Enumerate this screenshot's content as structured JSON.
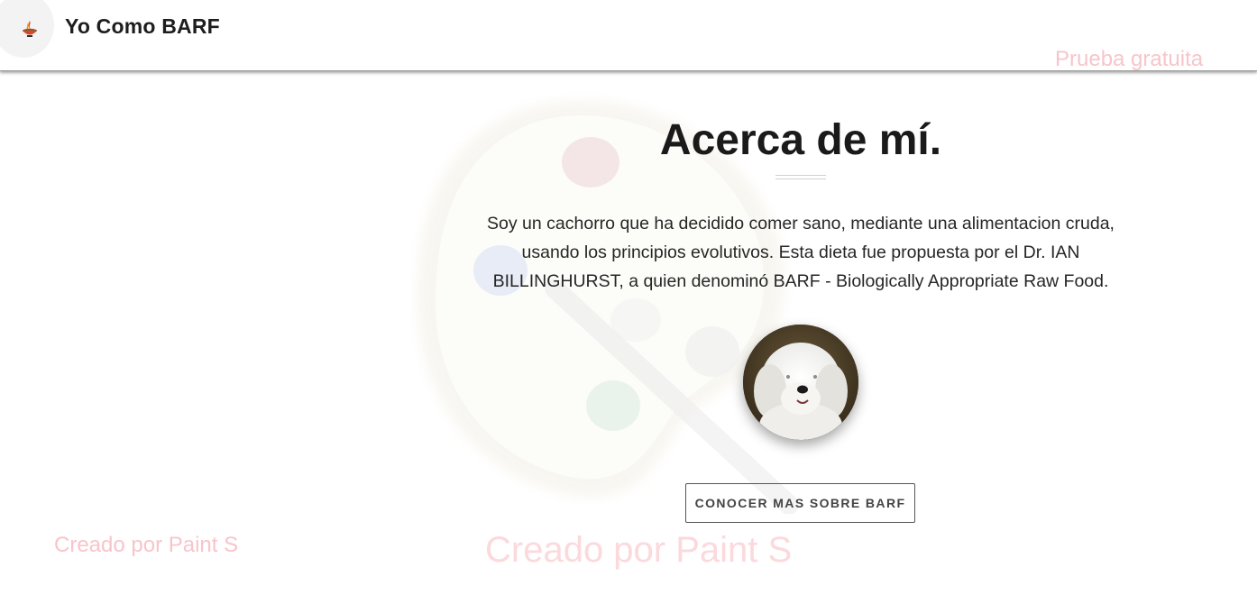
{
  "header": {
    "brand": "Yo Como BARF",
    "logo_icon": "fire-bowl-icon"
  },
  "watermarks": {
    "top_right": "Prueba gratuita",
    "bottom_left": "Creado por Paint S",
    "bottom_center": "Creado por Paint S"
  },
  "about": {
    "title": "Acerca de mí.",
    "description": "Soy un cachorro que ha decidido comer sano, mediante una alimentacion cruda, usando los principios evolutivos. Esta dieta fue propuesta por el Dr. IAN BILLINGHURST, a quien denominó BARF - Biologically Appropriate Raw Food.",
    "avatar_icon": "dog-avatar",
    "cta_label": "CONOCER MAS SOBRE BARF"
  },
  "colors": {
    "accent": "#1a1a1a",
    "watermark": "#f7c5ca",
    "background": "#ffffff"
  }
}
